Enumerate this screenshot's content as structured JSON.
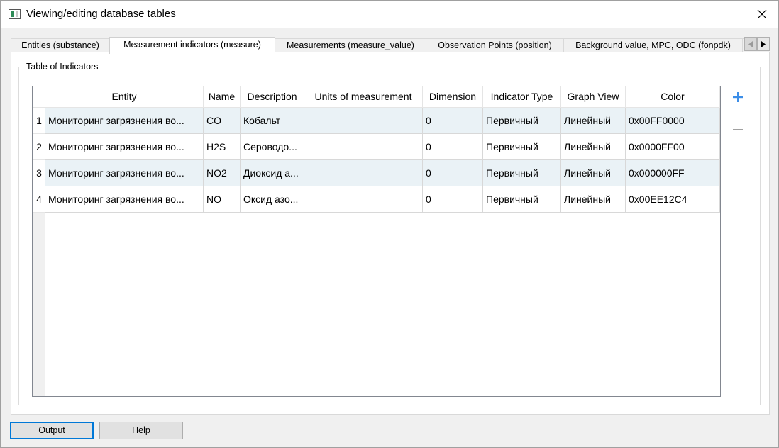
{
  "window": {
    "title": "Viewing/editing database tables"
  },
  "tabs": [
    {
      "label": "Entities (substance)"
    },
    {
      "label": "Measurement indicators (measure)"
    },
    {
      "label": "Measurements (measure_value)"
    },
    {
      "label": "Observation Points (position)"
    },
    {
      "label": "Background value, MPC, ODC (fonpdk)"
    }
  ],
  "active_tab": 1,
  "group": {
    "title": "Table of Indicators"
  },
  "table": {
    "columns": [
      "Entity",
      "Name",
      "Description",
      "Units of measurement",
      "Dimension",
      "Indicator Type",
      "Graph View",
      "Color"
    ],
    "rows": [
      {
        "num": "1",
        "cells": [
          "Мониторинг загрязнения во...",
          "CO",
          "Кобальт",
          "",
          "0",
          "Первичный",
          "Линейный",
          "0x00FF0000"
        ]
      },
      {
        "num": "2",
        "cells": [
          "Мониторинг загрязнения во...",
          "H2S",
          "Сероводо...",
          "",
          "0",
          "Первичный",
          "Линейный",
          "0x0000FF00"
        ]
      },
      {
        "num": "3",
        "cells": [
          "Мониторинг загрязнения во...",
          "NO2",
          "Диоксид а...",
          "",
          "0",
          "Первичный",
          "Линейный",
          "0x000000FF"
        ]
      },
      {
        "num": "4",
        "cells": [
          "Мониторинг загрязнения во...",
          "NO",
          "Оксид азо...",
          "",
          "0",
          "Первичный",
          "Линейный",
          "0x00EE12C4"
        ]
      }
    ]
  },
  "side_buttons": {
    "add_icon": "plus-icon",
    "remove_icon": "minus-icon"
  },
  "buttons": {
    "output": "Output",
    "help": "Help"
  },
  "colors": {
    "accent": "#0078d7",
    "plus": "#3c8ee8",
    "minus": "#a0a0a0",
    "row_alt": "#eaf2f6"
  }
}
